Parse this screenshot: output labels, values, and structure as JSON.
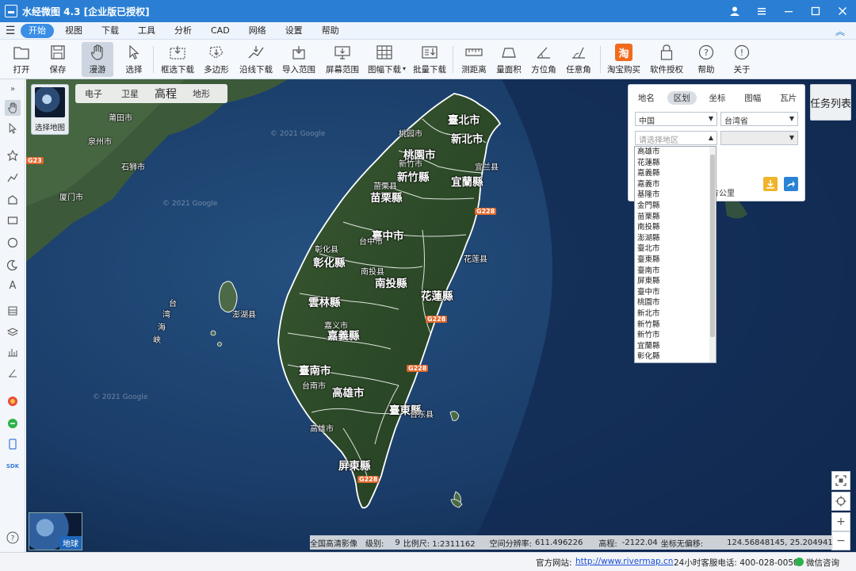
{
  "window": {
    "title": "水经微图 4.3 [企业版已授权]"
  },
  "menu": {
    "items": [
      "开始",
      "视图",
      "下载",
      "工具",
      "分析",
      "CAD",
      "网络",
      "设置",
      "帮助"
    ],
    "active": "开始"
  },
  "toolbar": {
    "open": "打开",
    "save": "保存",
    "pan": "漫游",
    "select": "选择",
    "rect_download": "框选下载",
    "polygon": "多边形",
    "line_download": "沿线下载",
    "import_range": "导入范围",
    "screen_range": "屏幕范围",
    "sheet_download": "图幅下载",
    "batch_download": "批量下载",
    "measure_distance": "测距离",
    "measure_area": "量面积",
    "azimuth": "方位角",
    "any_angle": "任意角",
    "taobao": "淘宝购买",
    "license": "软件授权",
    "help": "帮助",
    "about": "关于"
  },
  "map": {
    "thumb_label": "选择地图",
    "layer_tabs": [
      "电子",
      "卫星",
      "高程",
      "地形"
    ],
    "watermarks": [
      "© 2021 Google",
      "© 2021 Google",
      "© 2021 Google"
    ],
    "labels": {
      "north_taipei": "臺北市",
      "xinbei": "新北市",
      "taoyuan_city": "桃園市",
      "taoyuan": "桃园市",
      "hsinchu_county": "新竹縣",
      "hsinchu_city": "新竹市",
      "yilan_county": "宜蘭縣",
      "yilan": "宜兰县",
      "miaoli_county": "苗栗縣",
      "miaoli": "苗栗县",
      "taichung_city": "臺中市",
      "taichung": "台中市",
      "changhua_county": "彰化縣",
      "changhua": "彰化县",
      "nantou_county": "南投縣",
      "nantou": "南投县",
      "hualien_county": "花蓮縣",
      "hualien": "花莲县",
      "yunlin_county": "雲林縣",
      "yunlin": "云林县",
      "chiayi_county": "嘉義縣",
      "chiayi_city": "嘉义市",
      "tainan_city": "臺南市",
      "tainan": "台南市",
      "kaohsiung_city": "高雄市",
      "kaohsiung": "高雄市",
      "taitung_county": "臺東縣",
      "taitung": "台东县",
      "pingtung_county": "屏東縣",
      "penghu": "澎湖县",
      "quanzhou": "泉州市",
      "shishi": "石狮市",
      "xiamen": "厦门市",
      "putian": "莆田市",
      "taiwan_strait_1": "台",
      "taiwan_strait_2": "湾",
      "taiwan_strait_3": "海",
      "taiwan_strait_4": "峡",
      "route_g228": "G228",
      "route_g23": "G23"
    },
    "globe_label": "地球",
    "controls": [
      "extent-icon",
      "locate-icon",
      "zoom-in-icon",
      "zoom-out-icon"
    ]
  },
  "region_panel": {
    "tabs": [
      "地名",
      "区划",
      "坐标",
      "图幅",
      "瓦片"
    ],
    "active_tab": "区划",
    "country": "中国",
    "province": "台湾省",
    "region_placeholder": "请选择地区",
    "sub_region": "",
    "distance_label": "方公里",
    "dropdown_options": [
      "高雄市",
      "花蓮縣",
      "嘉義縣",
      "嘉義市",
      "基隆市",
      "金門縣",
      "苗栗縣",
      "南投縣",
      "澎湖縣",
      "臺北市",
      "臺東縣",
      "臺南市",
      "屏東縣",
      "臺中市",
      "桃園市",
      "新北市",
      "新竹縣",
      "新竹市",
      "宜蘭縣",
      "彰化縣"
    ]
  },
  "task_list": "任务列表",
  "map_status": {
    "source": "全国高清影像",
    "level_label": "级别:",
    "level": "9",
    "scale_label": "比例尺: 1:2311162",
    "resolution_label": "空间分辨率:",
    "resolution": "611.496226",
    "elevation_label": "高程:",
    "elevation": "-2122.04",
    "coord_label": "坐标无偏移:",
    "coord": "124.56848145, 25.20494115"
  },
  "statusbar": {
    "website_label": "官方网站:",
    "website": "http://www.rivermap.cn",
    "hotline": "24小时客服电话: 400-028-0050",
    "wechat": "微信咨询"
  }
}
